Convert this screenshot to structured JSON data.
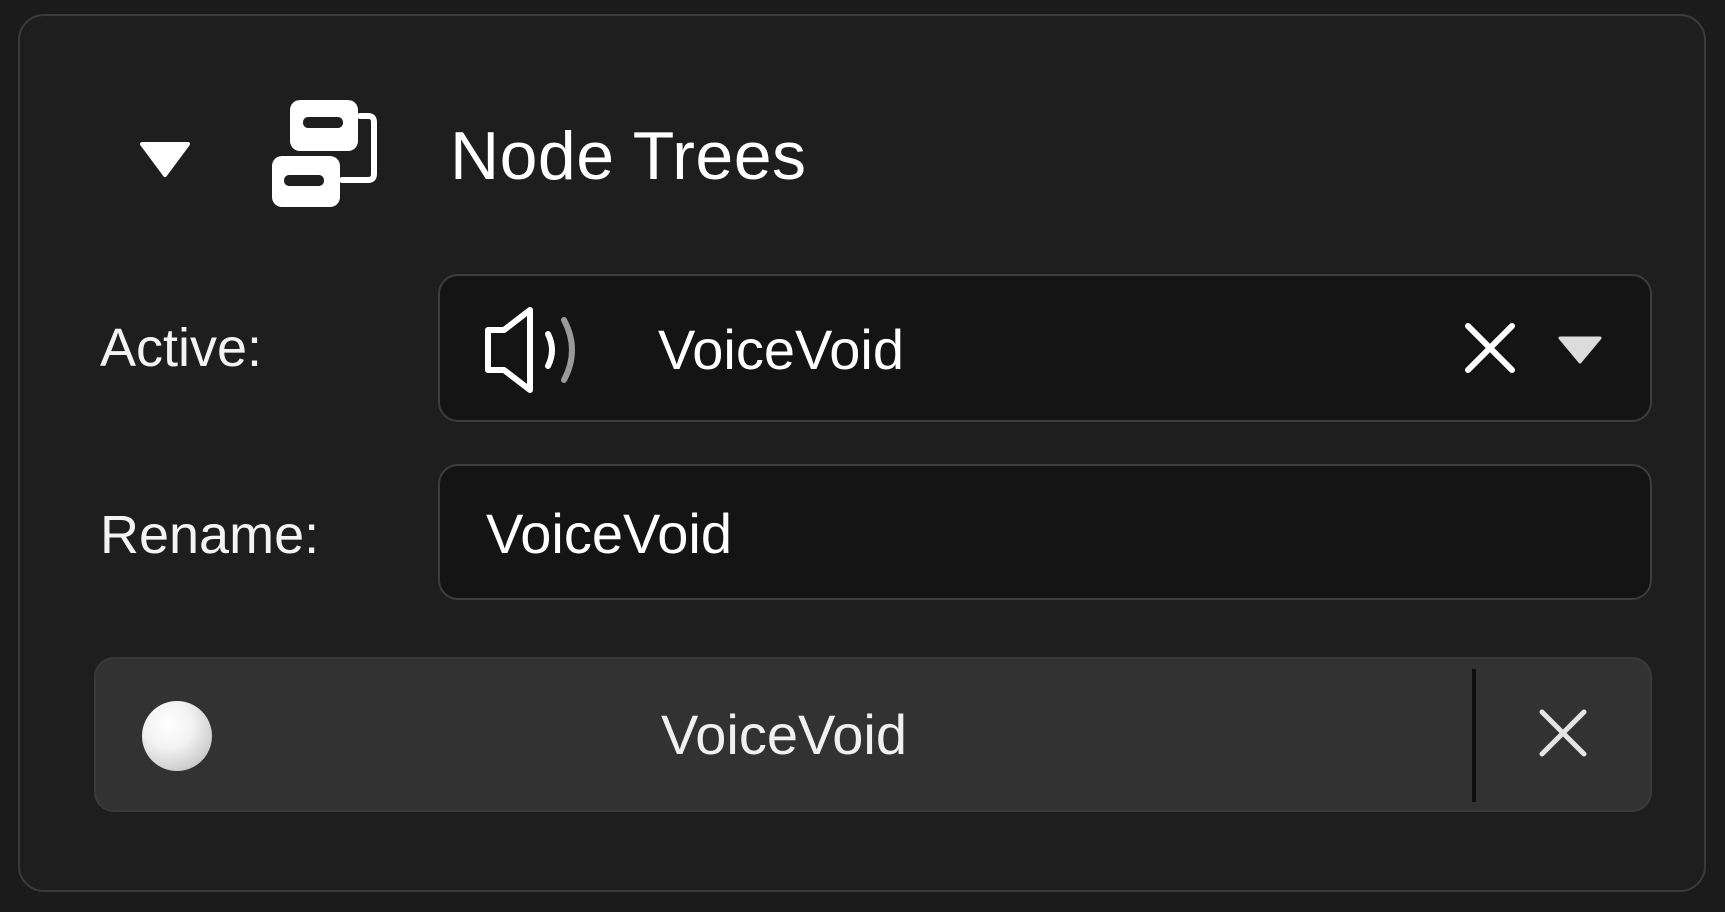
{
  "panel": {
    "title": "Node Trees",
    "icons": {
      "collapse": "triangle-down-icon",
      "header": "node-tree-icon"
    }
  },
  "active": {
    "label": "Active:",
    "value": "VoiceVoid",
    "icons": {
      "type": "speaker-icon",
      "clear": "close-icon",
      "dropdown": "triangle-down-icon"
    }
  },
  "rename": {
    "label": "Rename:",
    "value": "VoiceVoid"
  },
  "datablock": {
    "name": "VoiceVoid",
    "icons": {
      "preview": "sphere-icon",
      "unlink": "close-icon"
    }
  },
  "colors": {
    "background": "#1b1b1c",
    "panel": "#1e1e1f",
    "field": "#141415",
    "datablock": "#323232",
    "text": "#ffffff"
  }
}
